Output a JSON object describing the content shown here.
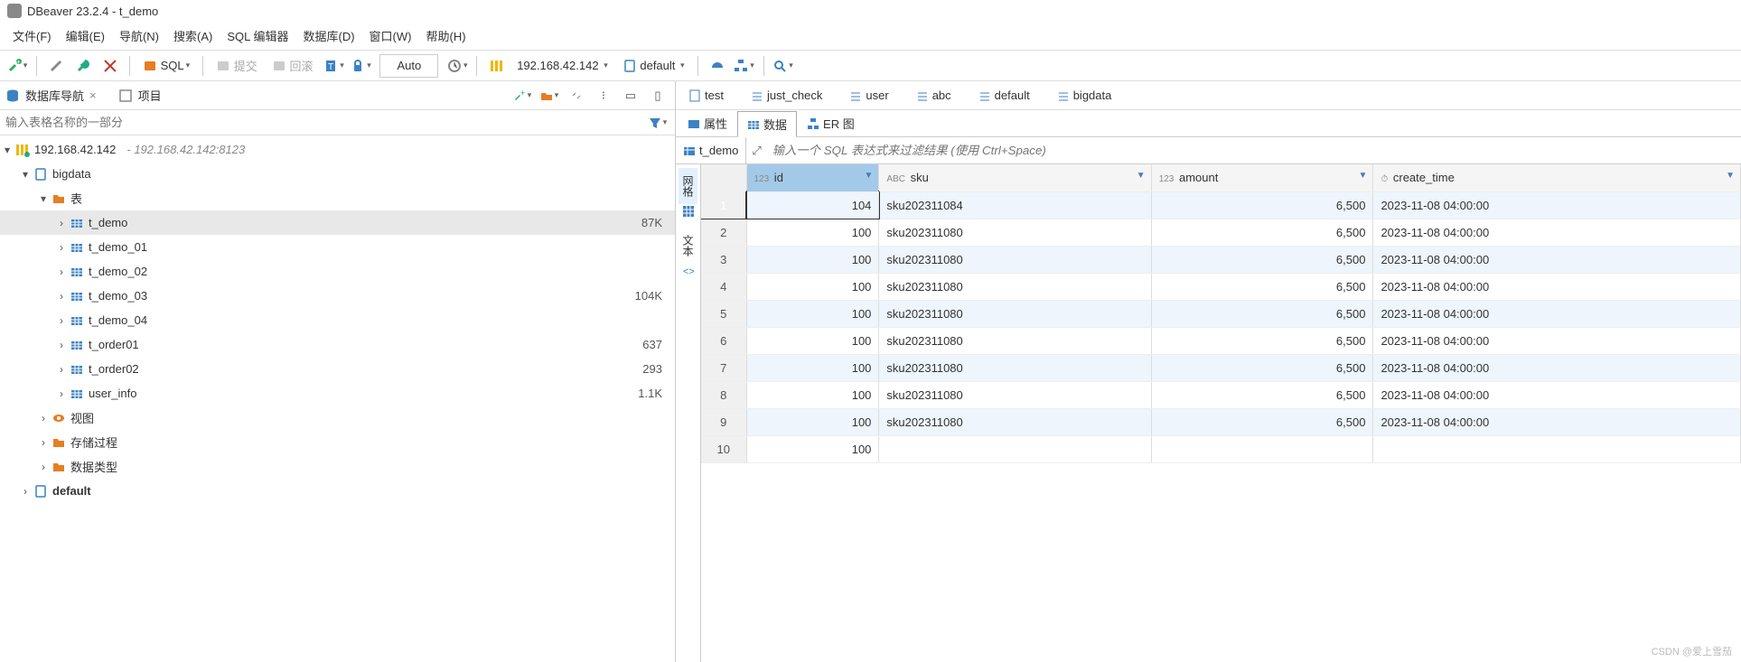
{
  "title": "DBeaver 23.2.4 - t_demo",
  "menu": [
    "文件(F)",
    "编辑(E)",
    "导航(N)",
    "搜索(A)",
    "SQL 编辑器",
    "数据库(D)",
    "窗口(W)",
    "帮助(H)"
  ],
  "toolbar": {
    "sql": "SQL",
    "commit": "提交",
    "rollback": "回滚",
    "auto": "Auto"
  },
  "conn": {
    "host": "192.168.42.142",
    "db": "default"
  },
  "nav": {
    "tab1": "数据库导航",
    "tab2": "项目",
    "filter_placeholder": "输入表格名称的一部分"
  },
  "tree": {
    "conn_label": "192.168.42.142",
    "conn_desc": "- 192.168.42.142:8123",
    "db1": "bigdata",
    "tables_label": "表",
    "items": [
      {
        "name": "t_demo",
        "size": "87K",
        "selected": true
      },
      {
        "name": "t_demo_01",
        "size": ""
      },
      {
        "name": "t_demo_02",
        "size": ""
      },
      {
        "name": "t_demo_03",
        "size": "104K"
      },
      {
        "name": "t_demo_04",
        "size": ""
      },
      {
        "name": "t_order01",
        "size": "637"
      },
      {
        "name": "t_order02",
        "size": "293"
      },
      {
        "name": "user_info",
        "size": "1.1K"
      }
    ],
    "views": "视图",
    "procs": "存储过程",
    "types": "数据类型",
    "db2": "default"
  },
  "editor_tabs": [
    "test",
    "just_check",
    "user",
    "abc",
    "default",
    "bigdata"
  ],
  "subtabs": {
    "props": "属性",
    "data": "数据",
    "er": "ER 图"
  },
  "table_label": "t_demo",
  "sql_filter_placeholder": "输入一个 SQL 表达式来过滤结果 (使用 Ctrl+Space)",
  "vtabs": {
    "grid": "网格",
    "text": "文本"
  },
  "columns": [
    {
      "type": "123",
      "name": "id",
      "sorted": true
    },
    {
      "type": "ABC",
      "name": "sku"
    },
    {
      "type": "123",
      "name": "amount"
    },
    {
      "type": "⏱",
      "name": "create_time"
    }
  ],
  "rows": [
    {
      "n": 1,
      "id": "104",
      "sku": "sku202311084",
      "amount": "6,500",
      "time": "2023-11-08 04:00:00",
      "sel": true
    },
    {
      "n": 2,
      "id": "100",
      "sku": "sku202311080",
      "amount": "6,500",
      "time": "2023-11-08 04:00:00"
    },
    {
      "n": 3,
      "id": "100",
      "sku": "sku202311080",
      "amount": "6,500",
      "time": "2023-11-08 04:00:00"
    },
    {
      "n": 4,
      "id": "100",
      "sku": "sku202311080",
      "amount": "6,500",
      "time": "2023-11-08 04:00:00"
    },
    {
      "n": 5,
      "id": "100",
      "sku": "sku202311080",
      "amount": "6,500",
      "time": "2023-11-08 04:00:00"
    },
    {
      "n": 6,
      "id": "100",
      "sku": "sku202311080",
      "amount": "6,500",
      "time": "2023-11-08 04:00:00"
    },
    {
      "n": 7,
      "id": "100",
      "sku": "sku202311080",
      "amount": "6,500",
      "time": "2023-11-08 04:00:00"
    },
    {
      "n": 8,
      "id": "100",
      "sku": "sku202311080",
      "amount": "6,500",
      "time": "2023-11-08 04:00:00"
    },
    {
      "n": 9,
      "id": "100",
      "sku": "sku202311080",
      "amount": "6,500",
      "time": "2023-11-08 04:00:00"
    },
    {
      "n": 10,
      "id": "100",
      "sku": "",
      "amount": "",
      "time": ""
    }
  ],
  "watermark": "CSDN @爱上雪茄"
}
